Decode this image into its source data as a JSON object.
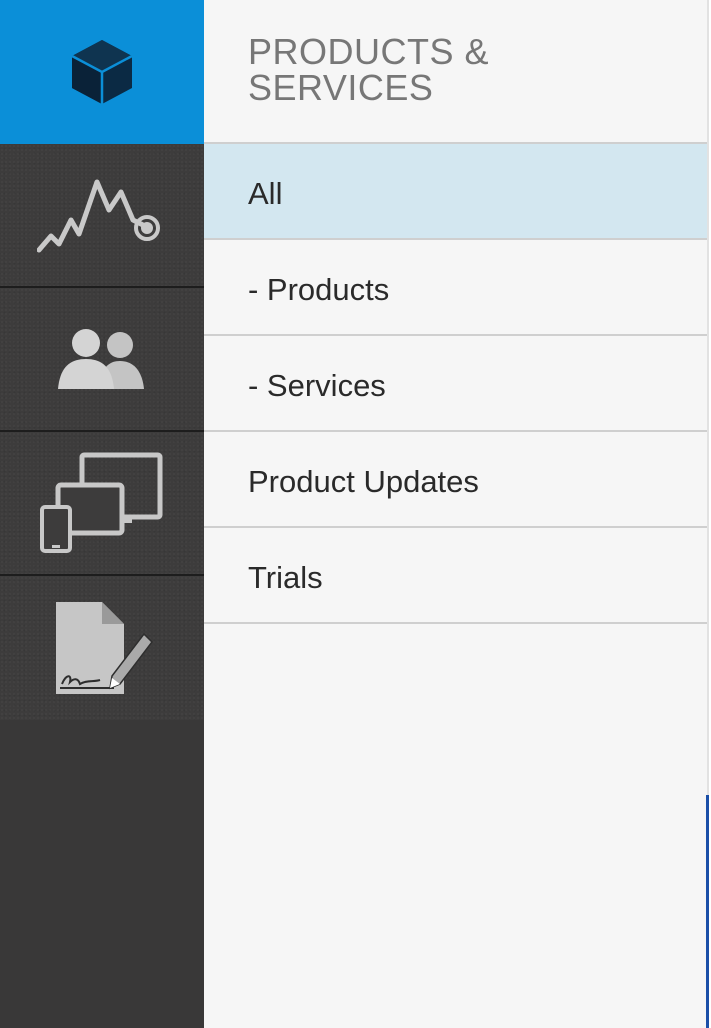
{
  "colors": {
    "accent": "#0b8fd8",
    "rail_background": "#3a3939",
    "panel_background": "#f6f6f6",
    "selected_row": "#d3e7f0",
    "title_text": "#777777"
  },
  "rail": {
    "items": [
      {
        "icon": "cube-icon",
        "active": true
      },
      {
        "icon": "activity-chart-icon",
        "active": false
      },
      {
        "icon": "users-icon",
        "active": false
      },
      {
        "icon": "devices-icon",
        "active": false
      },
      {
        "icon": "contract-signature-icon",
        "active": false
      }
    ]
  },
  "panel": {
    "title": "PRODUCTS & SERVICES",
    "items": [
      {
        "label": "All",
        "selected": true
      },
      {
        "label": "- Products",
        "selected": false
      },
      {
        "label": "- Services",
        "selected": false
      },
      {
        "label": "Product Updates",
        "selected": false
      },
      {
        "label": "Trials",
        "selected": false
      }
    ]
  }
}
